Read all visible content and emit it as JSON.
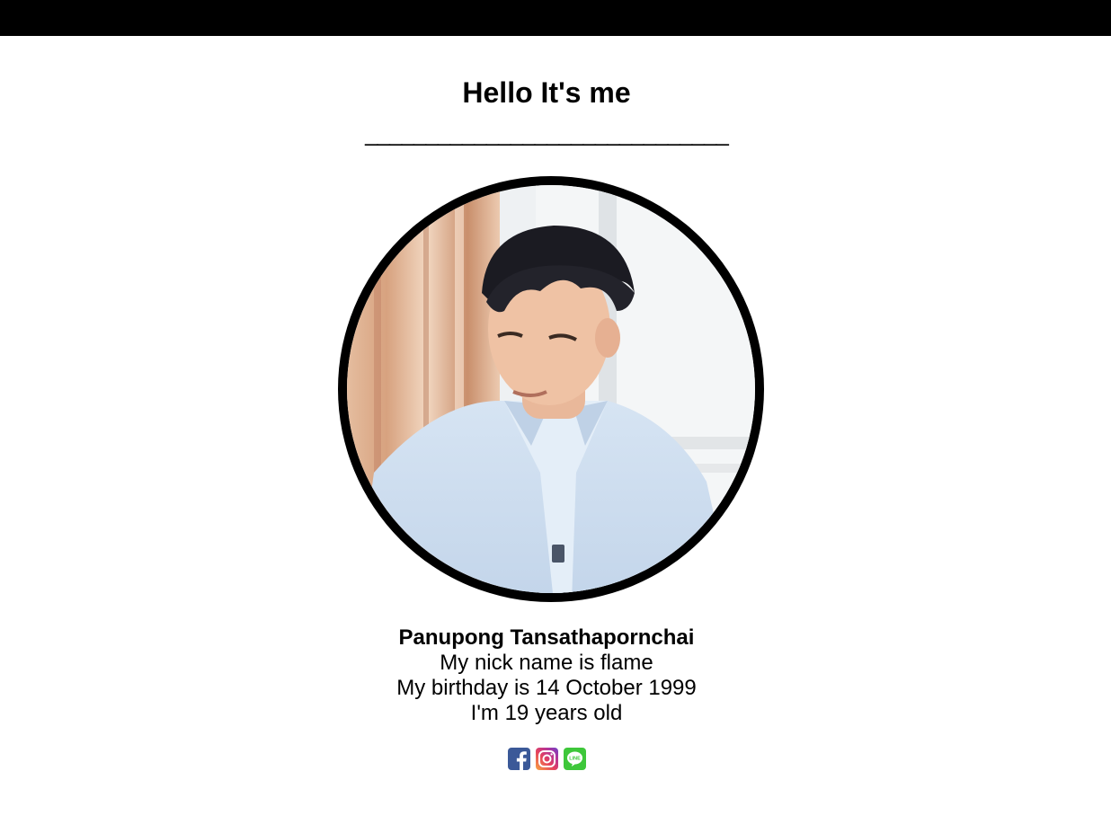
{
  "header": {
    "title": "Hello It's me",
    "divider": "______________________________"
  },
  "profile": {
    "name": "Panupong Tansathapornchai",
    "nickname_line": "My nick name is flame",
    "birthday_line": "My birthday is 14 October 1999",
    "age_line": "I'm 19 years old"
  },
  "socials": [
    {
      "icon": "facebook-icon",
      "color": "#3b5998"
    },
    {
      "icon": "instagram-icon",
      "color": "#e4405f"
    },
    {
      "icon": "line-icon",
      "color": "#3ec73a",
      "text": "LINE"
    }
  ]
}
